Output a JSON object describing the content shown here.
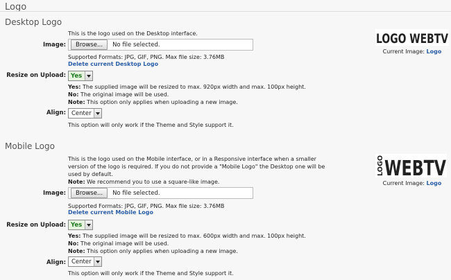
{
  "page_title": "Logo",
  "desktop": {
    "title": "Desktop Logo",
    "intro": "This is the logo used on the Desktop interface.",
    "image_label": "Image:",
    "browse": "Browse...",
    "file_status": "No file selected.",
    "formats": "Supported Formats: JPG, GIF, PNG. Max file size: 3.76MB",
    "delete_link": "Delete current Desktop Logo",
    "resize_label": "Resize on Upload:",
    "resize_value": "Yes",
    "yes_key": "Yes:",
    "yes_text": " The supplied image will be resized to max. 920px width and max. 100px height.",
    "no_key": "No:",
    "no_text": " The original image will be used.",
    "note_key": "Note:",
    "note_text": " This option only applies when uploading a new image.",
    "align_label": "Align:",
    "align_value": "Center",
    "align_note": "This option will only work if the Theme and Style support it.",
    "logo_text": "LOGO WEBTV",
    "current_prefix": "Current Image: ",
    "current_link": "Logo"
  },
  "mobile": {
    "title": "Mobile Logo",
    "intro1": "This is the logo used on the Mobile interface, or in a Responsive interface when a smaller",
    "intro2": "version of the logo is required. If you do not provide a \"Mobile Logo\" the Desktop one will be",
    "intro3": "used by default.",
    "note_key0": "Note:",
    "note_text0": " We recommend you to use a square-like image.",
    "image_label": "Image:",
    "browse": "Browse...",
    "file_status": "No file selected.",
    "formats": "Supported Formats: JPG, GIF, PNG. Max file size: 3.76MB",
    "delete_link": "Delete current Mobile Logo",
    "resize_label": "Resize on Upload:",
    "resize_value": "Yes",
    "yes_key": "Yes:",
    "yes_text": " The supplied image will be resized to max. 600px width and max. 100px height.",
    "no_key": "No:",
    "no_text": " The original image will be used.",
    "note_key": "Note:",
    "note_text": " This option only applies when uploading a new image.",
    "align_label": "Align:",
    "align_value": "Center",
    "align_note": "This option will only work if the Theme and Style support it.",
    "logo_vertical": "LOGO",
    "logo_main": "WEBTV",
    "current_prefix": "Current Image: ",
    "current_link": "Logo"
  }
}
